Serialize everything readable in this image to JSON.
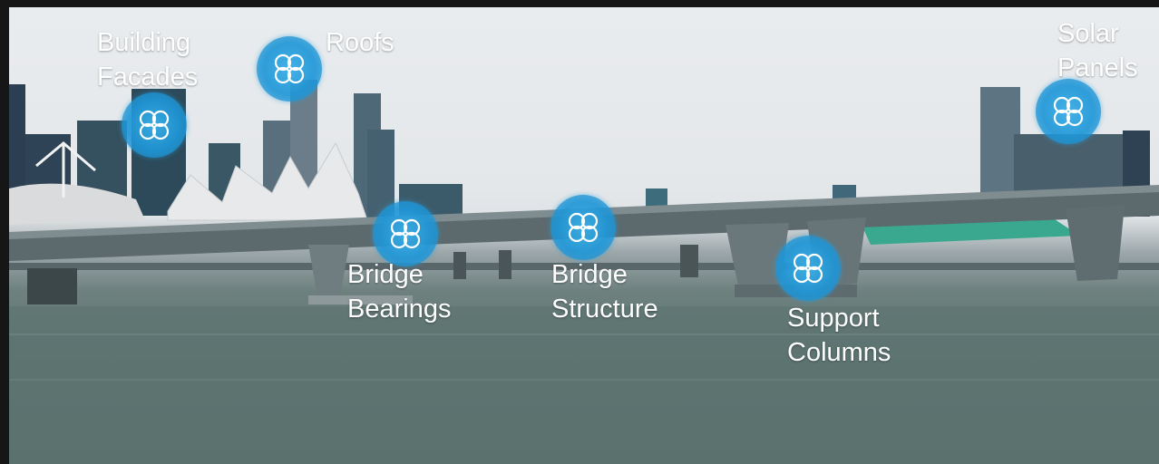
{
  "hotspots": [
    {
      "id": "building-facades",
      "label": "Building\nFacades",
      "icon": "drone-icon"
    },
    {
      "id": "roofs",
      "label": "Roofs",
      "icon": "drone-icon"
    },
    {
      "id": "bridge-bearings",
      "label": "Bridge\nBearings",
      "icon": "drone-icon"
    },
    {
      "id": "bridge-structure",
      "label": "Bridge\nStructure",
      "icon": "drone-icon"
    },
    {
      "id": "support-columns",
      "label": "Support\nColumns",
      "icon": "drone-icon"
    },
    {
      "id": "solar-panels",
      "label": "Solar\nPanels",
      "icon": "drone-icon"
    }
  ],
  "colors": {
    "hotspot": "#2a9ad6",
    "label": "#ffffff",
    "water": "#5f7573",
    "sky": "#e6e9eb"
  }
}
